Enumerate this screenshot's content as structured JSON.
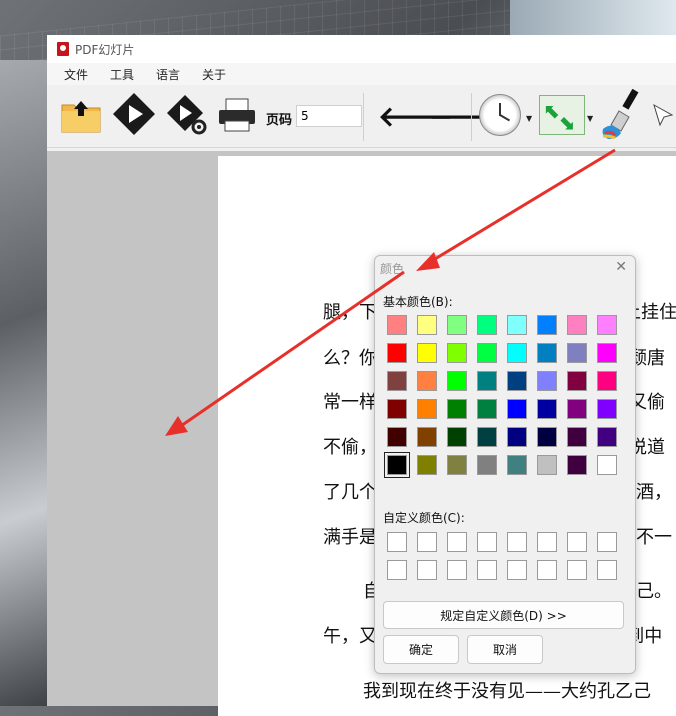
{
  "window": {
    "title": "PDF幻灯片"
  },
  "menu": [
    "文件",
    "工具",
    "语言",
    "关于"
  ],
  "toolbar": {
    "page_label": "页码",
    "page_value": "5"
  },
  "document": {
    "lines": [
      "腿，下",
      "么？你",
      "常一样",
      "不偷，",
      "了几个",
      "满手是",
      "自",
      "午，又",
      "我到现在终于没有见——大约孔乙己",
      "上挂住",
      "颓唐",
      "又偷",
      "说道",
      "了酒，",
      "，不一",
      "乙己。",
      "\"到中"
    ]
  },
  "color_dialog": {
    "title": "颜色",
    "basic_label": "基本颜色(B):",
    "custom_label": "自定义颜色(C):",
    "define_button": "规定自定义颜色(D) >>",
    "ok_button": "确定",
    "cancel_button": "取消",
    "basic_colors": [
      "#ff8080",
      "#ffff80",
      "#80ff80",
      "#00ff80",
      "#80ffff",
      "#0080ff",
      "#ff80c0",
      "#ff80ff",
      "#ff0000",
      "#ffff00",
      "#80ff00",
      "#00ff40",
      "#00ffff",
      "#0080c0",
      "#8080c0",
      "#ff00ff",
      "#804040",
      "#ff8040",
      "#00ff00",
      "#008080",
      "#004080",
      "#8080ff",
      "#800040",
      "#ff0080",
      "#800000",
      "#ff8000",
      "#008000",
      "#008040",
      "#0000ff",
      "#0000a0",
      "#800080",
      "#8000ff",
      "#400000",
      "#804000",
      "#004000",
      "#004040",
      "#000080",
      "#000040",
      "#400040",
      "#400080",
      "#000000",
      "#808000",
      "#808040",
      "#808080",
      "#408080",
      "#c0c0c0",
      "#400040",
      "#ffffff"
    ],
    "selected_index": 40,
    "custom_count": 16
  },
  "annotation_color": "#e8302a"
}
